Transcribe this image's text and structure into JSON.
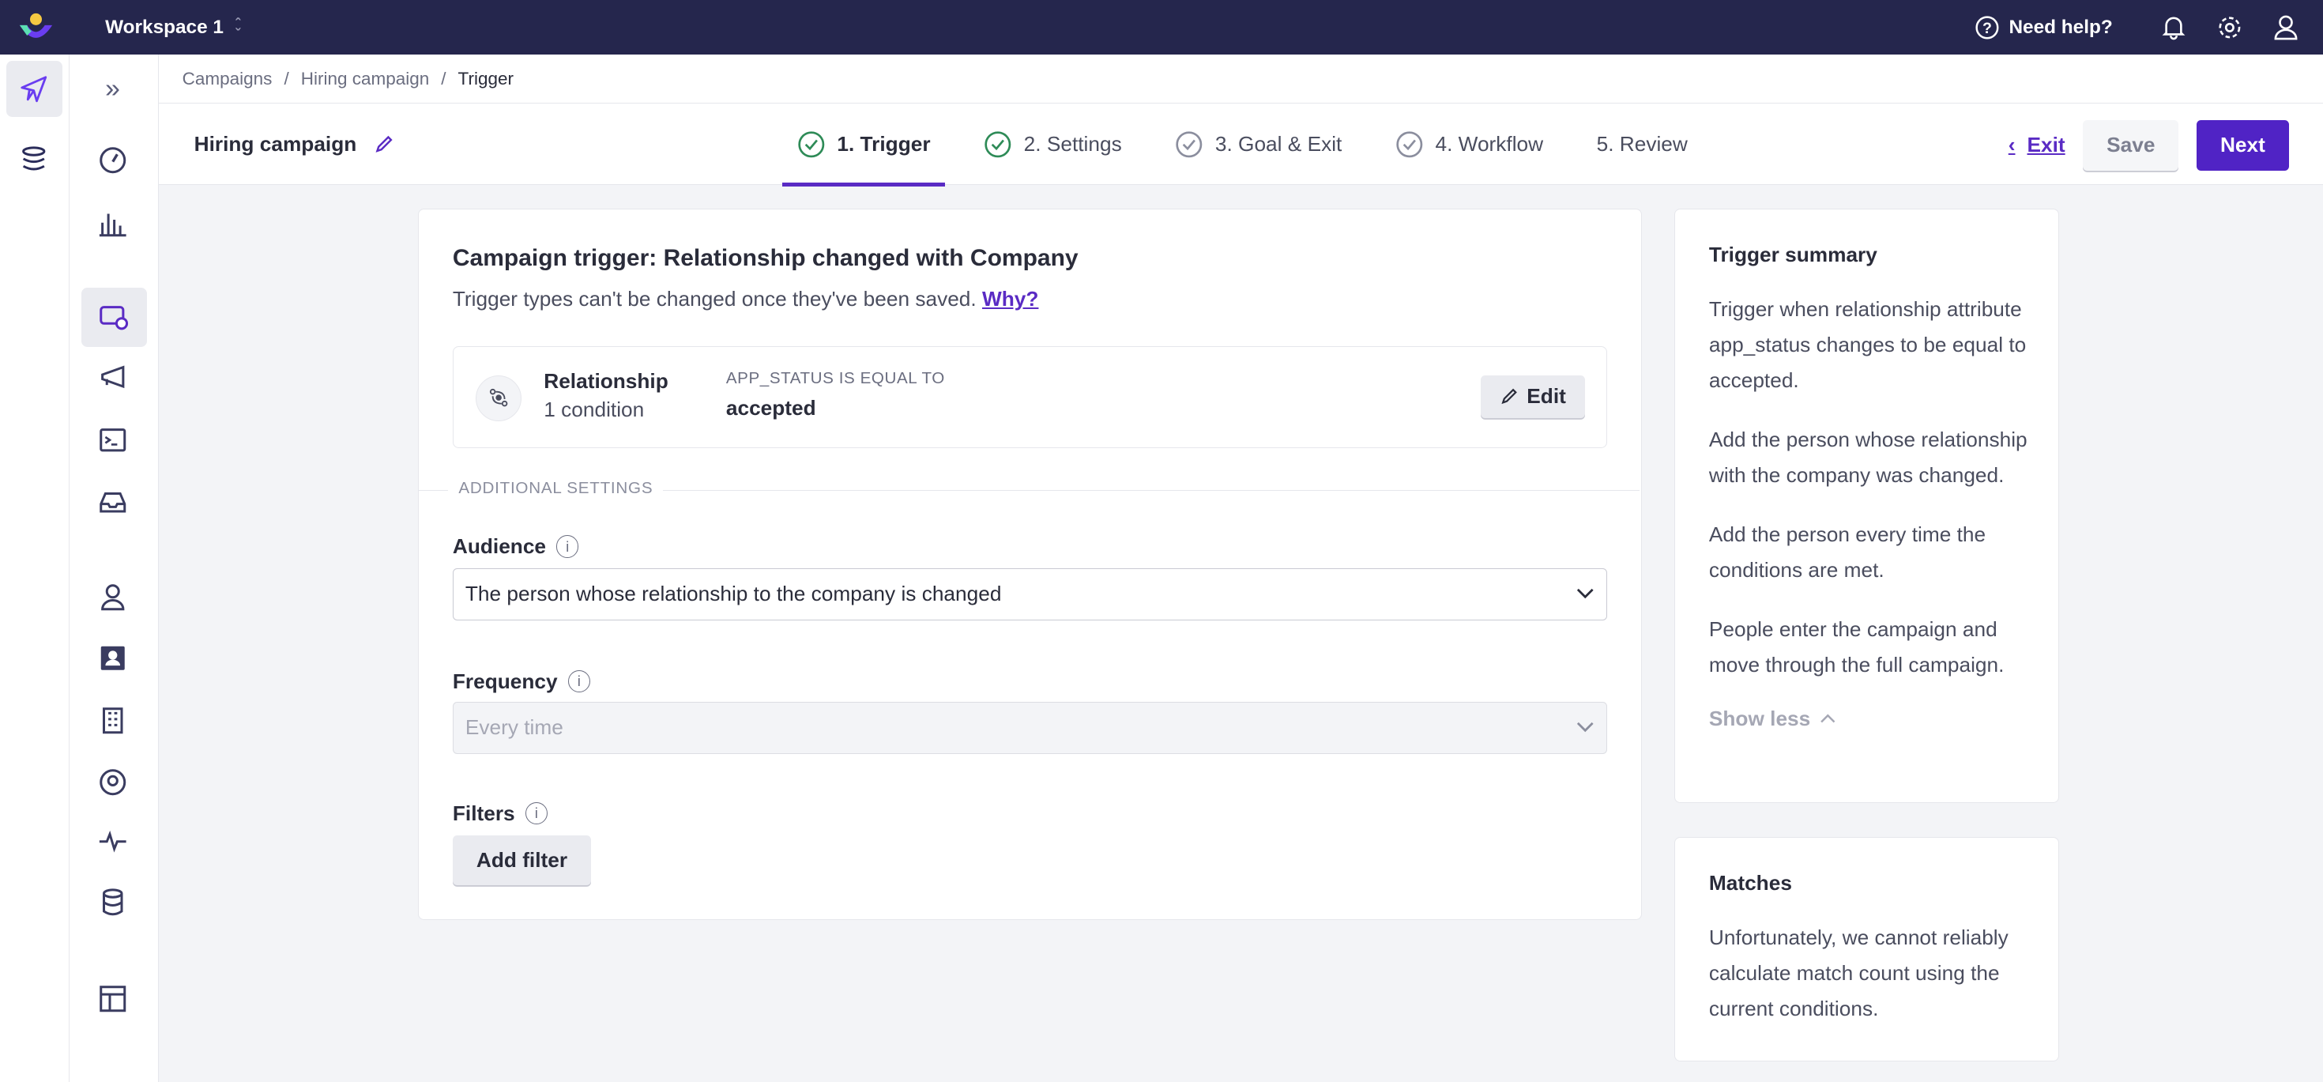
{
  "topbar": {
    "workspace": "Workspace 1",
    "help": "Need help?",
    "icons": [
      "help-circle-icon",
      "bell-icon",
      "gear-icon",
      "user-icon"
    ]
  },
  "breadcrumb": [
    "Campaigns",
    "Hiring campaign",
    "Trigger"
  ],
  "header": {
    "title": "Hiring campaign",
    "steps": [
      {
        "label": "1. Trigger",
        "done": true,
        "active": true
      },
      {
        "label": "2. Settings",
        "done": true
      },
      {
        "label": "3. Goal & Exit",
        "done": false
      },
      {
        "label": "4. Workflow",
        "done": false
      },
      {
        "label": "5. Review",
        "done": false
      }
    ],
    "exit": "Exit",
    "save": "Save",
    "next": "Next"
  },
  "main": {
    "title": "Campaign trigger: Relationship changed with Company",
    "subtitle": "Trigger types can't be changed once they've been saved.",
    "why": "Why?",
    "trigger": {
      "name": "Relationship",
      "count": "1 condition",
      "condition_label": "APP_STATUS IS EQUAL TO",
      "condition_value": "accepted",
      "edit": "Edit"
    },
    "additional": "ADDITIONAL SETTINGS",
    "audience": {
      "label": "Audience",
      "value": "The person whose relationship to the company is changed"
    },
    "frequency": {
      "label": "Frequency",
      "value": "Every time"
    },
    "filters": {
      "label": "Filters",
      "button": "Add filter"
    }
  },
  "summary": {
    "title": "Trigger summary",
    "paragraphs": [
      "Trigger when relationship attribute app_status changes to be equal to accepted.",
      "Add the person whose relationship with the company was changed.",
      "Add the person every time the conditions are met.",
      "People enter the campaign and move through the full campaign."
    ],
    "toggle": "Show less"
  },
  "matches": {
    "title": "Matches",
    "text": "Unfortunately, we cannot reliably calculate match count using the current conditions."
  },
  "colors": {
    "accent": "#5023c5",
    "topbar": "#25264d",
    "success": "#2e8b57"
  }
}
